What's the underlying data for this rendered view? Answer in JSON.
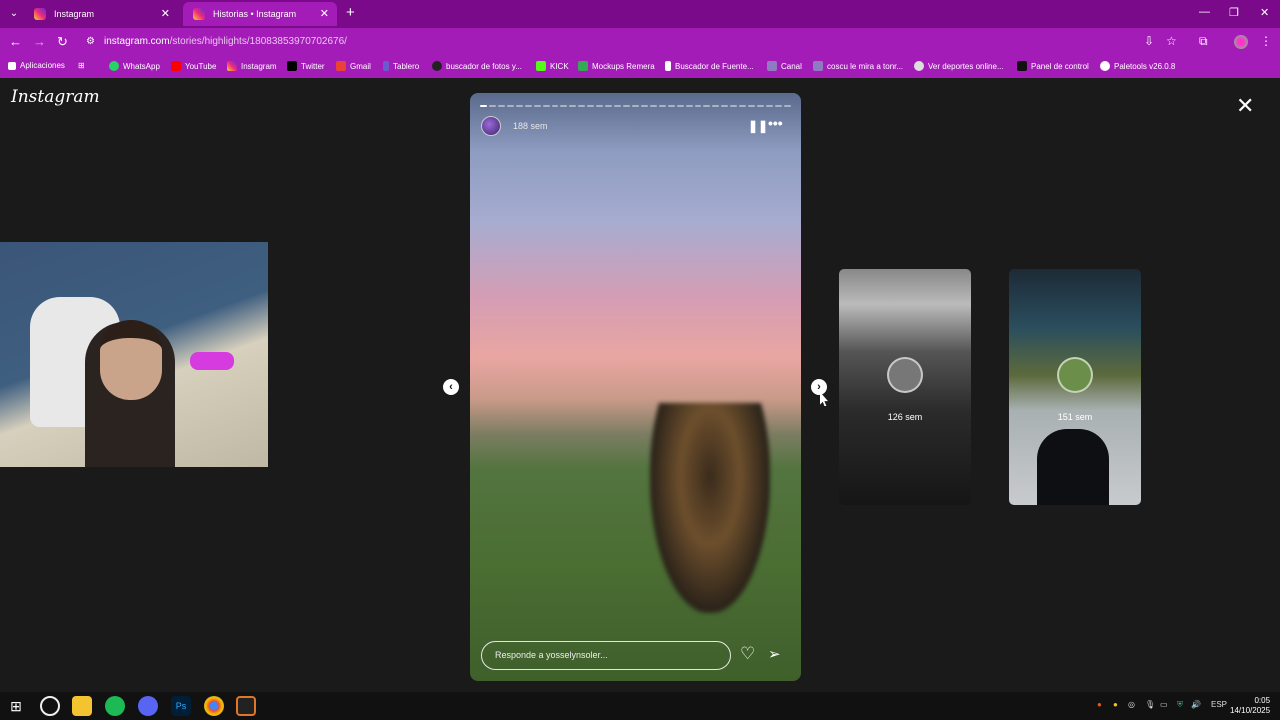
{
  "browser": {
    "tabs": [
      {
        "title": "Instagram"
      },
      {
        "title": "Historias • Instagram"
      }
    ],
    "url_host": "instagram.com",
    "url_path": "/stories/highlights/18083853970702676/",
    "bookmarks": [
      {
        "label": "Aplicaciones",
        "icon": "apps-grid-icon",
        "color": "#ffffff"
      },
      {
        "label": "WhatsApp",
        "icon": "whatsapp-icon",
        "color": "#25d366"
      },
      {
        "label": "YouTube",
        "icon": "youtube-icon",
        "color": "#ff0000"
      },
      {
        "label": "Instagram",
        "icon": "instagram-icon",
        "color": "#e1306c"
      },
      {
        "label": "Twitter",
        "icon": "x-icon",
        "color": "#000000"
      },
      {
        "label": "Gmail",
        "icon": "gmail-icon",
        "color": "#ea4335"
      },
      {
        "label": "Tablero",
        "icon": "tablero-icon",
        "color": "#6a5acd"
      },
      {
        "label": "buscador de fotos y...",
        "icon": "search-photos-icon",
        "color": "#222222"
      },
      {
        "label": "KICK",
        "icon": "kick-icon",
        "color": "#53fc18"
      },
      {
        "label": "Mockups Remera",
        "icon": "drive-icon",
        "color": "#34a853"
      },
      {
        "label": "Buscador de Fuente...",
        "icon": "font-search-icon",
        "color": "#ffffff"
      },
      {
        "label": "Canal",
        "icon": "canal-icon",
        "color": "#8e7cc3"
      },
      {
        "label": "coscu le mira a tonr...",
        "icon": "bookmark-icon",
        "color": "#8e7cc3"
      },
      {
        "label": "Ver deportes online...",
        "icon": "sports-icon",
        "color": "#dddddd"
      },
      {
        "label": "Panel de control",
        "icon": "fox-icon",
        "color": "#111111"
      },
      {
        "label": "Paletools v26.0.8",
        "icon": "paletools-icon",
        "color": "#ffffff"
      }
    ]
  },
  "page": {
    "logo": "Instagram",
    "story": {
      "time_ago": "188 sem",
      "reply_placeholder": "Responde a yosselynsoler...",
      "segments_done": 1,
      "segments_total": 35
    },
    "thumbnails": [
      {
        "label": "126 sem"
      },
      {
        "label": "151 sem"
      }
    ]
  },
  "taskbar": {
    "language": "ESP",
    "time": "0:05",
    "date": "14/10/2025"
  },
  "colors": {
    "chrome_frame": "#7a0a8a",
    "chrome_toolbar": "#a41cb8",
    "page_bg": "#1a1a1a"
  }
}
